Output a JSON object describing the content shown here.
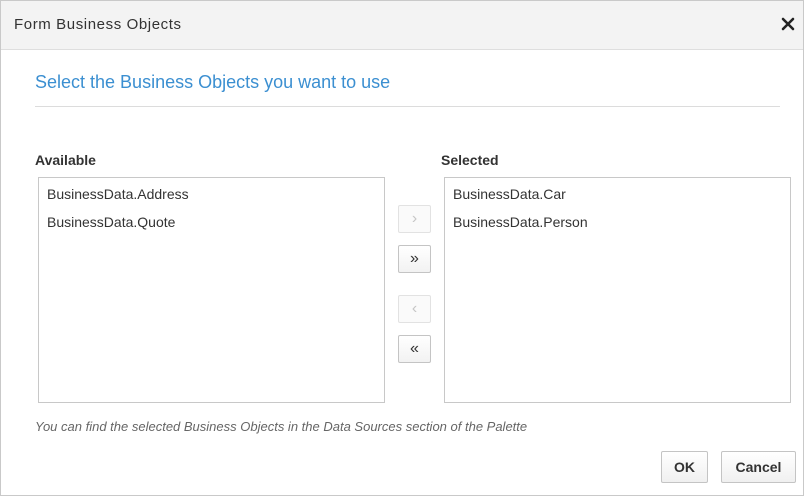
{
  "dialog": {
    "title": "Form Business Objects",
    "close_icon": "close-icon"
  },
  "heading": "Select the Business Objects you want to use",
  "available": {
    "label": "Available",
    "items": [
      "BusinessData.Address",
      "BusinessData.Quote"
    ]
  },
  "selected": {
    "label": "Selected",
    "items": [
      "BusinessData.Car",
      "BusinessData.Person"
    ]
  },
  "shuttle": {
    "move_right": "›",
    "move_all_right": "»",
    "move_left": "‹",
    "move_all_left": "«"
  },
  "hint": "You can find the selected Business Objects in the Data Sources section of the Palette",
  "buttons": {
    "ok": "OK",
    "cancel": "Cancel"
  },
  "colors": {
    "accent": "#3b8fd1",
    "title_bar": "#f3f3f3",
    "border": "#c8c8c8"
  }
}
